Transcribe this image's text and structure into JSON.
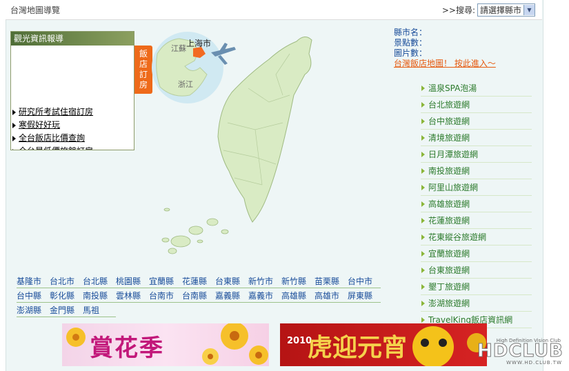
{
  "header": {
    "page_title": "台灣地圖導覽",
    "search_label": ">>搜尋:",
    "select_value": "請選擇縣市"
  },
  "news": {
    "title": "觀光資訊報導",
    "items": [
      "研究所考試住宿訂房",
      "寒假好好玩",
      "全台飯店比價查詢",
      "全台最低價旅館訂房"
    ]
  },
  "hotel_tab": [
    "飯",
    "店",
    "訂",
    "房"
  ],
  "map_labels": {
    "shanghai": "上海市",
    "jiangsu": "江蘇",
    "zhejiang": "浙江"
  },
  "info": {
    "county_label": "縣市名：",
    "spots_label": "景點數：",
    "images_label": "圖片數：",
    "hotel_map_link": "台灣飯店地圖！ 按此進入～"
  },
  "links": [
    "溫泉SPA泡湯",
    "台北旅遊網",
    "台中旅遊網",
    "清境旅遊網",
    "日月潭旅遊網",
    "南投旅遊網",
    "阿里山旅遊網",
    "高雄旅遊網",
    "花蓮旅遊網",
    "花東縱谷旅遊網",
    "宜蘭旅遊網",
    "台東旅遊網",
    "墾丁旅遊網",
    "澎湖旅遊網",
    "TravelKing飯店資訊網"
  ],
  "counties": [
    [
      "基隆市",
      "台北市",
      "台北縣",
      "桃園縣",
      "宜蘭縣",
      "花蓮縣",
      "台東縣",
      "新竹市",
      "新竹縣",
      "苗栗縣",
      "台中市"
    ],
    [
      "台中縣",
      "彰化縣",
      "南投縣",
      "雲林縣",
      "台南市",
      "台南縣",
      "嘉義縣",
      "嘉義市",
      "高雄縣",
      "高雄市",
      "屏東縣"
    ],
    [
      "澎湖縣",
      "金門縣",
      "馬祖"
    ]
  ],
  "banners": {
    "flower": "賞花季",
    "lantern": "虎迎元宵",
    "lantern_year": "2010"
  },
  "watermark": {
    "main": "HDCLUB",
    "top": "High Definition Vision Club",
    "url": "WWW.HD.CLUB.TW"
  },
  "colors": {
    "accent_orange": "#ee6a1a",
    "link_blue": "#1a4d9a",
    "link_green": "#2b7a2b",
    "map_green": "#d9ebc4"
  }
}
